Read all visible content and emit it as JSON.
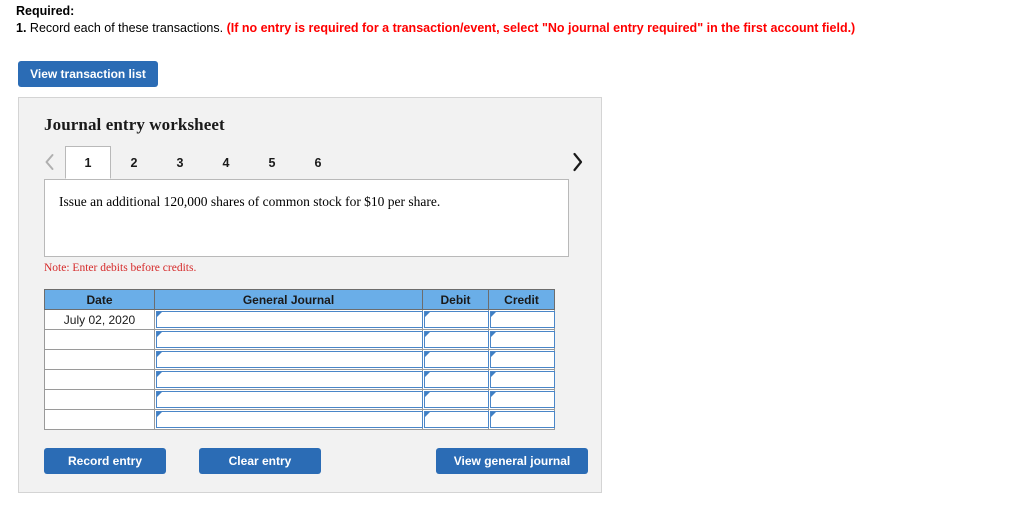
{
  "instructions": {
    "heading": "Required:",
    "item_number": "1.",
    "item_text": "Record each of these transactions.",
    "hint": "(If no entry is required for a transaction/event, select \"No journal entry required\" in the first account field.)"
  },
  "toolbar": {
    "view_transaction_list_label": "View transaction list"
  },
  "worksheet": {
    "title": "Journal entry worksheet",
    "tabs": [
      {
        "label": "1",
        "active": true
      },
      {
        "label": "2",
        "active": false
      },
      {
        "label": "3",
        "active": false
      },
      {
        "label": "4",
        "active": false
      },
      {
        "label": "5",
        "active": false
      },
      {
        "label": "6",
        "active": false
      }
    ],
    "prev_icon": "chevron-left-icon",
    "next_icon": "chevron-right-icon",
    "transaction_description": "Issue an additional 120,000 shares of common stock for $10 per share.",
    "note": "Note: Enter debits before credits.",
    "table": {
      "columns": [
        "Date",
        "General Journal",
        "Debit",
        "Credit"
      ],
      "rows": [
        {
          "date": "July 02, 2020",
          "general_journal": "",
          "debit": "",
          "credit": ""
        },
        {
          "date": "",
          "general_journal": "",
          "debit": "",
          "credit": ""
        },
        {
          "date": "",
          "general_journal": "",
          "debit": "",
          "credit": ""
        },
        {
          "date": "",
          "general_journal": "",
          "debit": "",
          "credit": ""
        },
        {
          "date": "",
          "general_journal": "",
          "debit": "",
          "credit": ""
        },
        {
          "date": "",
          "general_journal": "",
          "debit": "",
          "credit": ""
        }
      ]
    },
    "actions": {
      "record_entry_label": "Record entry",
      "clear_entry_label": "Clear entry",
      "view_general_journal_label": "View general journal"
    }
  },
  "colors": {
    "button_blue": "#2b6cb5",
    "table_header_blue": "#6aaee8",
    "hint_red": "#ff0000",
    "note_red": "#d62b2b",
    "panel_gray": "#f2f2f2"
  }
}
